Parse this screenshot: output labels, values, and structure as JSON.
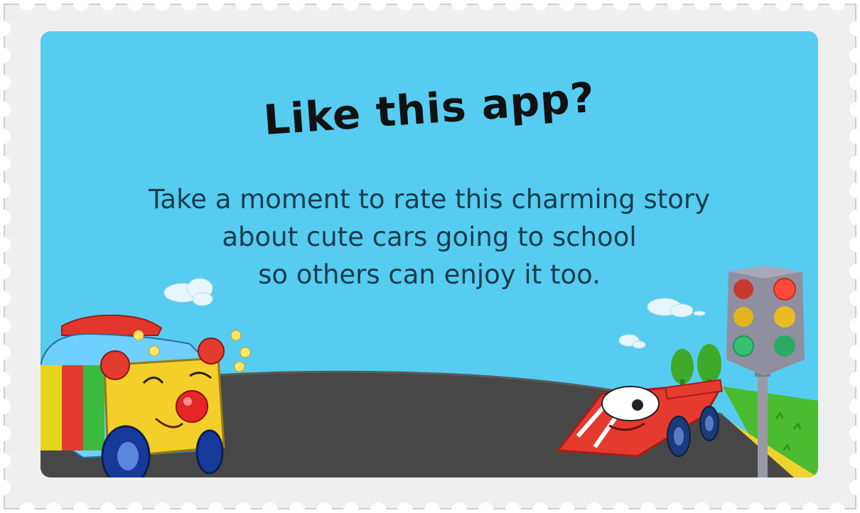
{
  "dialog": {
    "title": "Like this app?",
    "message_lines": [
      "Take a moment to rate this charming story",
      "about cute cars going to school",
      "so others can enjoy it too."
    ]
  },
  "colors": {
    "sky": "#56ccf0",
    "road": "#474747",
    "stamp_border": "#eeeeee",
    "title_text": "#111111",
    "body_text": "#173c4e"
  },
  "icons": {
    "clown_car": "clown-car-illustration",
    "race_car": "race-car-illustration",
    "traffic_light": "traffic-light-illustration"
  }
}
